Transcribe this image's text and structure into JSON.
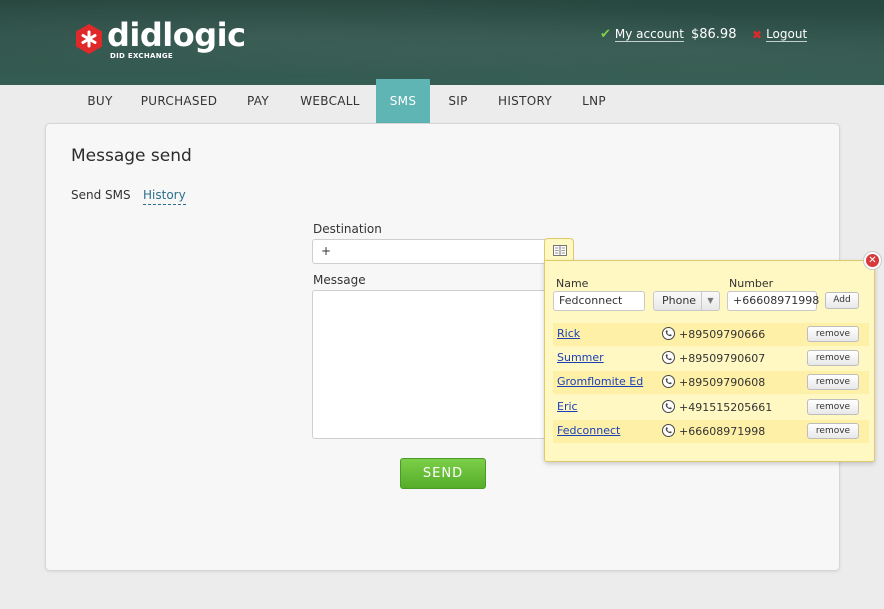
{
  "brand": {
    "name": "didlogic",
    "tagline": "DID EXCHANGE",
    "accent": "#e02a2a"
  },
  "header": {
    "my_account_label": "My account",
    "balance": "$86.98",
    "logout_label": "Logout"
  },
  "nav": {
    "items": [
      {
        "label": "BUY"
      },
      {
        "label": "PURCHASED"
      },
      {
        "label": "PAY"
      },
      {
        "label": "WEBCALL"
      },
      {
        "label": "SMS",
        "active": true
      },
      {
        "label": "SIP"
      },
      {
        "label": "HISTORY"
      },
      {
        "label": "LNP"
      }
    ],
    "active_color": "#5eb5b4"
  },
  "page": {
    "title": "Message send",
    "subtabs": [
      "Send SMS",
      "History"
    ]
  },
  "form": {
    "destination_label": "Destination",
    "destination_value": "+",
    "message_label": "Message",
    "send_label": "SEND"
  },
  "contacts": {
    "name_label": "Name",
    "number_label": "Number",
    "name_value": "Fedconnect",
    "type_value": "Phone",
    "number_value": "+66608971998",
    "add_label": "Add",
    "remove_label": "remove",
    "list": [
      {
        "name": "Rick",
        "number": "+89509790666"
      },
      {
        "name": "Summer",
        "number": "+89509790607"
      },
      {
        "name": "Gromflomite Ed",
        "number": "+89509790608"
      },
      {
        "name": "Eric",
        "number": "+491515205661"
      },
      {
        "name": "Fedconnect",
        "number": "+66608971998"
      }
    ]
  }
}
